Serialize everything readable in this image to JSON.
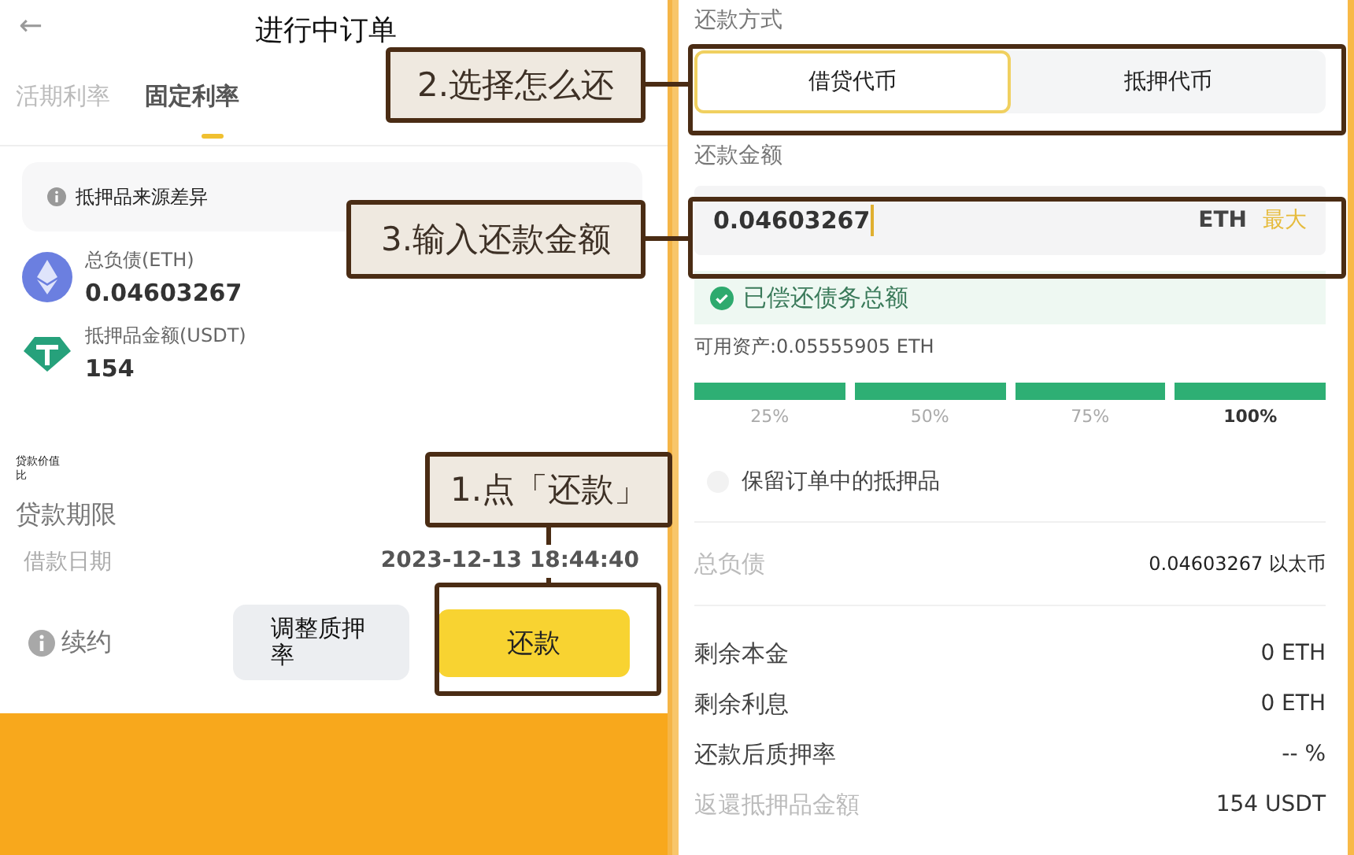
{
  "left_screen": {
    "back_icon": "←",
    "title": "进行中订单",
    "tabs": [
      {
        "label": "活期利率",
        "selected": false
      },
      {
        "label": "固定利率",
        "selected": true
      }
    ],
    "notice": "抵押品来源差异",
    "assets": [
      {
        "kind": "eth",
        "label": "总负债(ETH)",
        "value": "0.04603267"
      },
      {
        "kind": "usdt",
        "label": "抵押品金额(USDT)",
        "value": "154"
      }
    ],
    "ltv_label": "贷款价值比",
    "term_label": "贷款期限",
    "date_label": "借款日期",
    "date_value": "2023-12-13 18:44:40",
    "renew": "续约",
    "adjust_button": "调整质押率",
    "repay_button": "还款"
  },
  "right_screen": {
    "method_label": "还款方式",
    "methods": [
      {
        "label": "借贷代币",
        "selected": true
      },
      {
        "label": "抵押代币",
        "selected": false
      }
    ],
    "amount_label": "还款金额",
    "amount_value": "0.04603267",
    "currency": "ETH",
    "max": "最大",
    "status": "已偿还债务总额",
    "available": "可用资产:0.05555905 ETH",
    "percents": [
      {
        "label": "25%",
        "selected": false
      },
      {
        "label": "50%",
        "selected": false
      },
      {
        "label": "75%",
        "selected": false
      },
      {
        "label": "100%",
        "selected": true
      }
    ],
    "keep_collateral": {
      "label": "保留订单中的抵押品",
      "checked": false
    },
    "rows": [
      {
        "label": "总负债",
        "value": "0.04603267 以太币",
        "muted": true
      },
      {
        "label": "剩余本金",
        "value": "0 ETH",
        "muted": false
      },
      {
        "label": "剩余利息",
        "value": "0 ETH",
        "muted": false
      },
      {
        "label": "还款后质押率",
        "value": "-- %",
        "muted": false
      },
      {
        "label": "返還抵押品金額",
        "value": "154 USDT",
        "muted": true
      }
    ]
  },
  "annotations": [
    {
      "text": "2.选择怎么还"
    },
    {
      "text": "3.输入还款金额"
    },
    {
      "text": "1.点「还款」"
    }
  ]
}
